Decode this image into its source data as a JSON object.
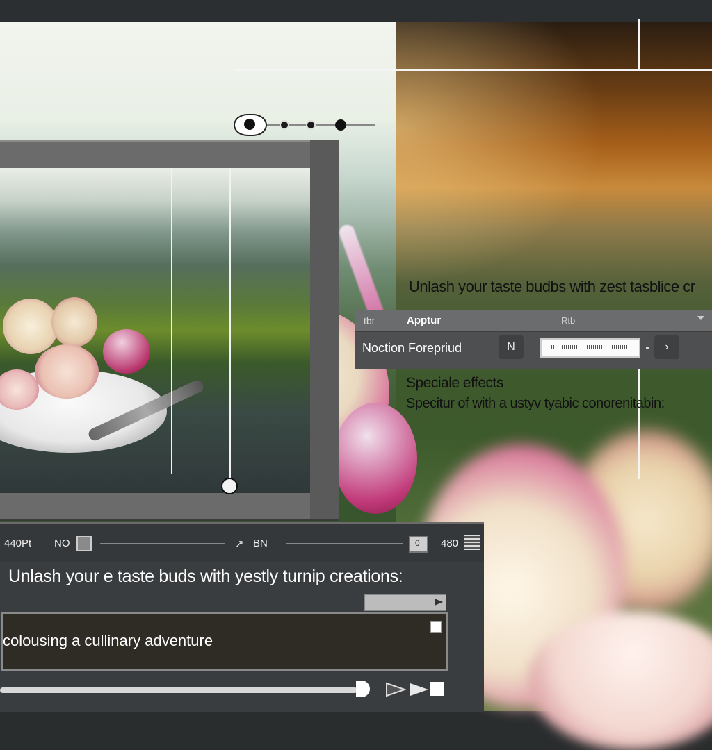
{
  "toolbar_top": {
    "slider_positions": [
      0.3,
      0.5,
      0.75
    ]
  },
  "side": {
    "title": "Unlash your taste budbs with zest tasblice cr",
    "effects_title": "Speciale effects",
    "effects_desc": "Specitur of with a ustyv tyabic conorenitabin:"
  },
  "property_panel": {
    "header_left": "tbt",
    "header_title": "Apptur",
    "header_right": "Rtb",
    "label": "Noction Forepriud",
    "button_left": "N",
    "button_right": "›"
  },
  "bottom_toolbar": {
    "left_value": "440Pt",
    "no_label": "NO",
    "arrow": "↗",
    "bn_label": "BN",
    "right_value": "480",
    "indicator": "0"
  },
  "bottom_panel": {
    "heading": "Unlash your e taste buds with yestly turnip creations:",
    "textarea_value": "colousing a cullinary adventure"
  },
  "colors": {
    "panel_bg": "#3a3d3f",
    "textarea_bg": "#2f2c25",
    "accent_pink": "#d24a8c"
  },
  "icons": [
    "eye-icon",
    "slider-knob",
    "dropdown-arrow-icon",
    "menu-icon",
    "play-icon",
    "stop-icon",
    "checkbox-icon"
  ]
}
